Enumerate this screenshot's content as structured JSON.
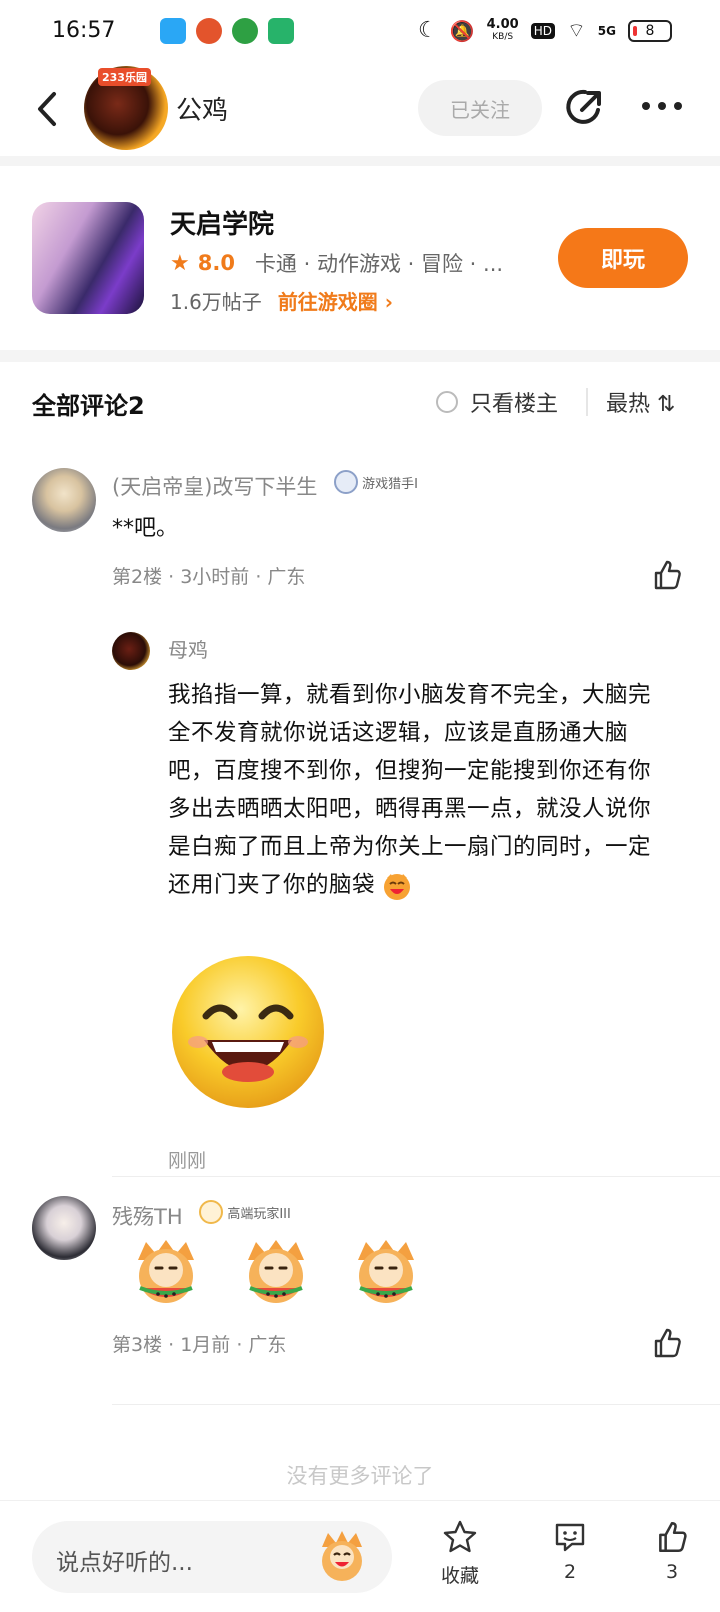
{
  "status_bar": {
    "time": "16:57",
    "network_speed": "4.00",
    "network_unit": "KB/S",
    "hd": "HD",
    "signal": "5G",
    "battery": "8"
  },
  "header": {
    "group_badge": "233乐园",
    "group_name": "公鸡",
    "follow_label": "已关注"
  },
  "game": {
    "title": "天启学院",
    "rating": "8.0",
    "tags": "卡通 · 动作游戏 · 冒险 · ...",
    "posts": "1.6万帖子",
    "goto_label": "前往游戏圈 ›",
    "play_label": "即玩"
  },
  "comments_header": {
    "title": "全部评论2",
    "only_op": "只看楼主",
    "sort": "最热 ⇅"
  },
  "comments": [
    {
      "user": "(天启帝皇)改写下半生",
      "badge": "游戏猎手I",
      "text": "**吧。",
      "meta": "第2楼 · 3小时前 · 广东",
      "reply": {
        "user": "母鸡",
        "text": "我掐指一算，就看到你小脑发育不完全，大脑完全不发育就你说话这逻辑，应该是直肠通大脑吧，百度搜不到你，但搜狗一定能搜到你还有你多出去晒晒太阳吧，晒得再黑一点，就没人说你是白痴了而且上帝为你关上一扇门的同时，一定还用门夹了你的脑袋",
        "time": "刚刚"
      }
    },
    {
      "user": "残殇TH",
      "badge": "高端玩家III",
      "meta": "第3楼 · 1月前 · 广东"
    }
  ],
  "no_more": "没有更多评论了",
  "bottom_bar": {
    "input_placeholder": "说点好听的...",
    "favorite_label": "收藏",
    "comment_count": "2",
    "like_count": "3"
  },
  "colors": {
    "accent": "#f57818",
    "text_secondary": "#888888"
  }
}
